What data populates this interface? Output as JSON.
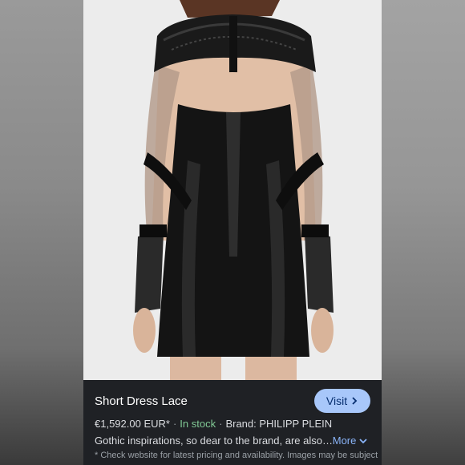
{
  "product": {
    "title": "Short Dress Lace",
    "visit_label": "Visit",
    "visit_icon": "chevron-right-icon",
    "price": "€1,592.00 EUR*",
    "separator": "·",
    "stock": "In stock",
    "brand": "Brand: PHILIPP PLEIN",
    "description": "Gothic inspirations, so dear to the brand, are also…",
    "more_label": "More",
    "more_icon": "chevron-down-icon",
    "disclaimer": "* Check website for latest pricing and availability. Images may be subject"
  },
  "colors": {
    "panel_bg": "#1f2125",
    "visit_button": "#a8c7fa",
    "stock_green": "#81c995",
    "link_blue": "#8ab4f8"
  }
}
